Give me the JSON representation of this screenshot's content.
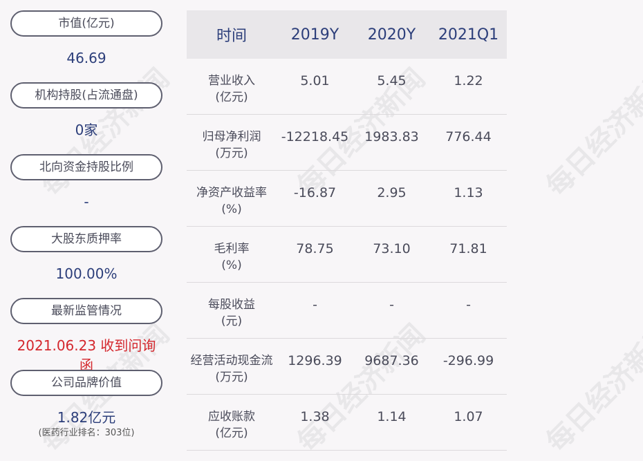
{
  "left": {
    "items": [
      {
        "label": "市值(亿元)",
        "value": "46.69"
      },
      {
        "label": "机构持股(占流通盘)",
        "value": "0家"
      },
      {
        "label": "北向资金持股比例",
        "value": "-"
      },
      {
        "label": "大股东质押率",
        "value": "100.00%"
      },
      {
        "label": "最新监管情况",
        "value": "2021.06.23 收到问询函"
      },
      {
        "label": "公司品牌价值",
        "value": "1.82亿元",
        "sub": "(医药行业排名：303位)"
      }
    ]
  },
  "table": {
    "headers": [
      "时间",
      "2019Y",
      "2020Y",
      "2021Q1"
    ],
    "rows": [
      {
        "label": [
          "营业收入",
          "(亿元)"
        ],
        "values": [
          "5.01",
          "5.45",
          "1.22"
        ]
      },
      {
        "label": [
          "归母净利润",
          "(万元)"
        ],
        "values": [
          "-12218.45",
          "1983.83",
          "776.44"
        ]
      },
      {
        "label": [
          "净资产收益率",
          "(%)"
        ],
        "values": [
          "-16.87",
          "2.95",
          "1.13"
        ]
      },
      {
        "label": [
          "毛利率",
          "(%)"
        ],
        "values": [
          "78.75",
          "73.10",
          "71.81"
        ]
      },
      {
        "label": [
          "每股收益",
          "(元)"
        ],
        "values": [
          "-",
          "-",
          "-"
        ]
      },
      {
        "label": [
          "经营活动现金流",
          "(万元)"
        ],
        "values": [
          "1296.39",
          "9687.36",
          "-296.99"
        ]
      },
      {
        "label": [
          "应收账款",
          "(亿元)"
        ],
        "values": [
          "1.38",
          "1.14",
          "1.07"
        ]
      }
    ]
  },
  "watermark": "每日经济新闻"
}
